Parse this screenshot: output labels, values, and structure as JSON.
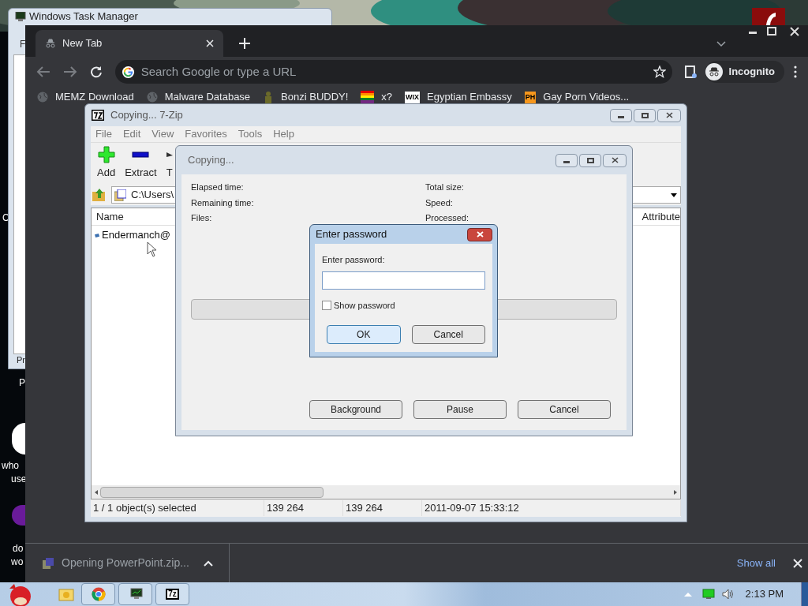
{
  "desktop": {
    "icon_labels": [
      "C",
      "P",
      "who",
      "use",
      "do",
      "wo"
    ]
  },
  "task_manager": {
    "title": "Windows Task Manager",
    "menu_letter": "F",
    "tab_letters": "Pr"
  },
  "browser": {
    "tabs": [
      {
        "title": "New Tab",
        "selected": true
      }
    ],
    "address": {
      "placeholder": "Search Google or type a URL"
    },
    "profile": "Incognito",
    "bookmarks": [
      {
        "label": "MEMZ Download",
        "kind": "globe"
      },
      {
        "label": "Malware Database",
        "kind": "globe"
      },
      {
        "label": "Bonzi BUDDY!",
        "kind": "figure"
      },
      {
        "label": "x?",
        "kind": "rainbow"
      },
      {
        "label": "Egyptian Embassy",
        "kind": "badge",
        "badge": "WIX",
        "color": "#ffffff"
      },
      {
        "label": "Gay Porn Videos...",
        "kind": "badge",
        "badge": "PH",
        "color": "#f7971d"
      }
    ],
    "download": {
      "file": "Opening PowerPoint.zip...",
      "show_all": "Show all"
    }
  },
  "zip_window": {
    "title": "Copying... 7-Zip",
    "menu": [
      "File",
      "Edit",
      "View",
      "Favorites",
      "Tools",
      "Help"
    ],
    "toolbar": [
      {
        "label": "Add",
        "kind": "add"
      },
      {
        "label": "Extract",
        "kind": "extract"
      },
      {
        "label": "T",
        "kind": "test"
      }
    ],
    "path": "C:\\Users\\",
    "columns": [
      "Name",
      "Attribute"
    ],
    "rows": [
      {
        "name": "Endermanch@",
        "selected": false
      }
    ],
    "status": [
      "1 / 1 object(s) selected",
      "139 264",
      "139 264",
      "2011-09-07 15:33:12"
    ]
  },
  "copy_dialog": {
    "title": "Copying...",
    "left_labels": [
      "Elapsed time:",
      "Remaining time:",
      "Files:"
    ],
    "right_labels": [
      "Total size:",
      "Speed:",
      "Processed:"
    ],
    "progress": {
      "level": 0
    },
    "buttons": [
      "Background",
      "Pause",
      "Cancel"
    ]
  },
  "password_dialog": {
    "title": "Enter password",
    "label": "Enter password:",
    "show_password": {
      "label": "Show password",
      "checked": false
    },
    "buttons": [
      {
        "label": "OK",
        "selected": true
      },
      {
        "label": "Cancel",
        "selected": false
      }
    ]
  },
  "taskbar": {
    "apps": [
      {
        "kind": "chrome"
      },
      {
        "kind": "monitor"
      },
      {
        "kind": "sevenzip",
        "badge": "7z"
      }
    ],
    "clock": "2:13 PM"
  }
}
